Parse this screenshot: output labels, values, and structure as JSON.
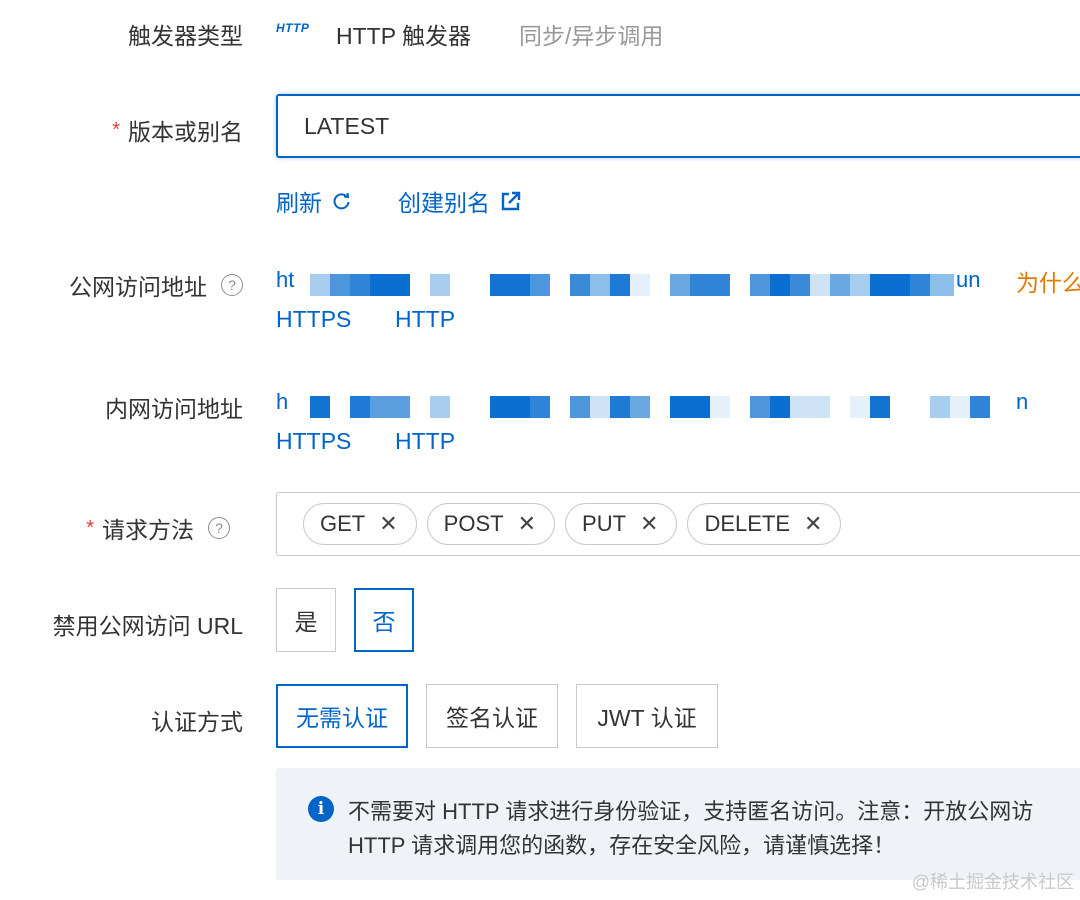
{
  "trigger": {
    "label": "触发器类型",
    "badge": "HTTP",
    "name": "HTTP 触发器",
    "mode": "同步/异步调用"
  },
  "version": {
    "required_mark": "*",
    "label": "版本或别名",
    "value": "LATEST",
    "refresh_label": "刷新",
    "create_alias_label": "创建别名"
  },
  "public_url": {
    "label": "公网访问地址",
    "help_icon": "help-circle-icon",
    "prefix": "ht",
    "suffix": "un",
    "why_label": "为什么",
    "https_label": "HTTPS",
    "http_label": "HTTP"
  },
  "internal_url": {
    "label": "内网访问地址",
    "prefix": "h",
    "suffix": "n",
    "https_label": "HTTPS",
    "http_label": "HTTP"
  },
  "methods": {
    "required_mark": "*",
    "label": "请求方法",
    "help_icon": "help-circle-icon",
    "tags": [
      "GET",
      "POST",
      "PUT",
      "DELETE"
    ],
    "remove_glyph": "✕"
  },
  "disable_public": {
    "label": "禁用公网访问 URL",
    "options": [
      "是",
      "否"
    ],
    "selected": "否"
  },
  "auth": {
    "label": "认证方式",
    "options": [
      "无需认证",
      "签名认证",
      "JWT 认证"
    ],
    "selected": "无需认证"
  },
  "notice": {
    "icon": "info-icon",
    "line1": "不需要对 HTTP 请求进行身份验证，支持匿名访问。注意：开放公网访",
    "line2": "HTTP 请求调用您的函数，存在安全风险，请谨慎选择！"
  },
  "watermark": "@稀土掘金技术社区",
  "colors": {
    "primary": "#0064c8",
    "required": "#e23c39",
    "warning": "#e07a00",
    "notice_bg": "#eff3f8"
  }
}
